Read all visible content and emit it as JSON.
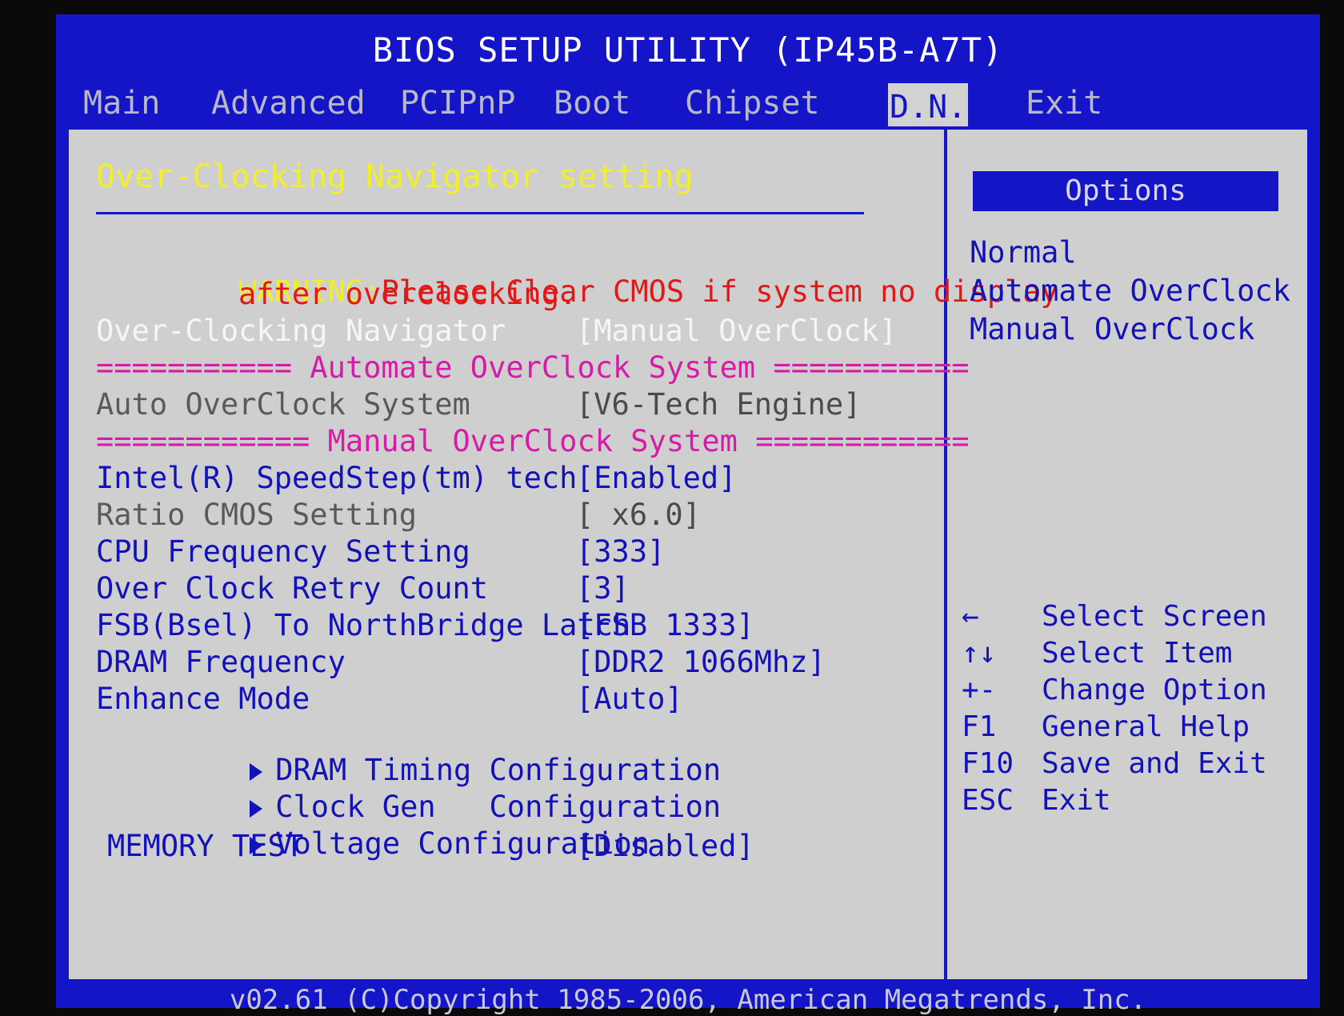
{
  "title": "BIOS SETUP UTILITY (IP45B-A7T)",
  "tabs": [
    {
      "label": "Main"
    },
    {
      "label": "Advanced"
    },
    {
      "label": "PCIPnP"
    },
    {
      "label": "Boot"
    },
    {
      "label": "Chipset"
    },
    {
      "label": "D.N.E"
    },
    {
      "label": "Exit"
    }
  ],
  "active_tab": "D.N.E",
  "section_title": "Over-Clocking Navigator setting",
  "warning": {
    "prefix": "WARNING:",
    "line1": "Please Clear CMOS if system no display",
    "line2": "after overclocking."
  },
  "settings": {
    "navigator": {
      "label": "Over-Clocking Navigator",
      "value": "[Manual OverClock]"
    },
    "auto_divider": "=========== Automate OverClock System ===========",
    "auto_system": {
      "label": "Auto OverClock System",
      "value": "[V6-Tech Engine]"
    },
    "manual_divider": "============ Manual OverClock System ============",
    "speedstep": {
      "label": "Intel(R) SpeedStep(tm) tech",
      "value": "[Enabled]"
    },
    "ratio": {
      "label": "Ratio CMOS Setting",
      "value": "[ x6.0]"
    },
    "cpu_freq": {
      "label": "CPU Frequency Setting",
      "value": "[333]"
    },
    "retry": {
      "label": "Over Clock Retry Count",
      "value": "[3]"
    },
    "fsb": {
      "label": "FSB(Bsel) To NorthBridge Latch",
      "value": "[FSB 1333]"
    },
    "dram_freq": {
      "label": "DRAM Frequency",
      "value": "[DDR2 1066Mhz]"
    },
    "enhance": {
      "label": "Enhance Mode",
      "value": "[Auto]"
    },
    "dram_timing": {
      "label": "DRAM Timing Configuration"
    },
    "clock_gen": {
      "label": "Clock Gen   Configuration"
    },
    "voltage": {
      "label": "Voltage Configuration"
    },
    "memory_test": {
      "label": "MEMORY TEST",
      "value": "[Disabled]"
    }
  },
  "options": {
    "header": "Options",
    "items": [
      "Normal",
      "Automate OverClock",
      "Manual OverClock"
    ]
  },
  "help_keys": [
    {
      "key": "←",
      "desc": "Select Screen"
    },
    {
      "key": "↑↓",
      "desc": "Select Item"
    },
    {
      "key": "+-",
      "desc": "Change Option"
    },
    {
      "key": "F1",
      "desc": "General Help"
    },
    {
      "key": "F10",
      "desc": "Save and Exit"
    },
    {
      "key": "ESC",
      "desc": "Exit"
    }
  ],
  "footer": "v02.61 (C)Copyright 1985-2006, American Megatrends, Inc."
}
